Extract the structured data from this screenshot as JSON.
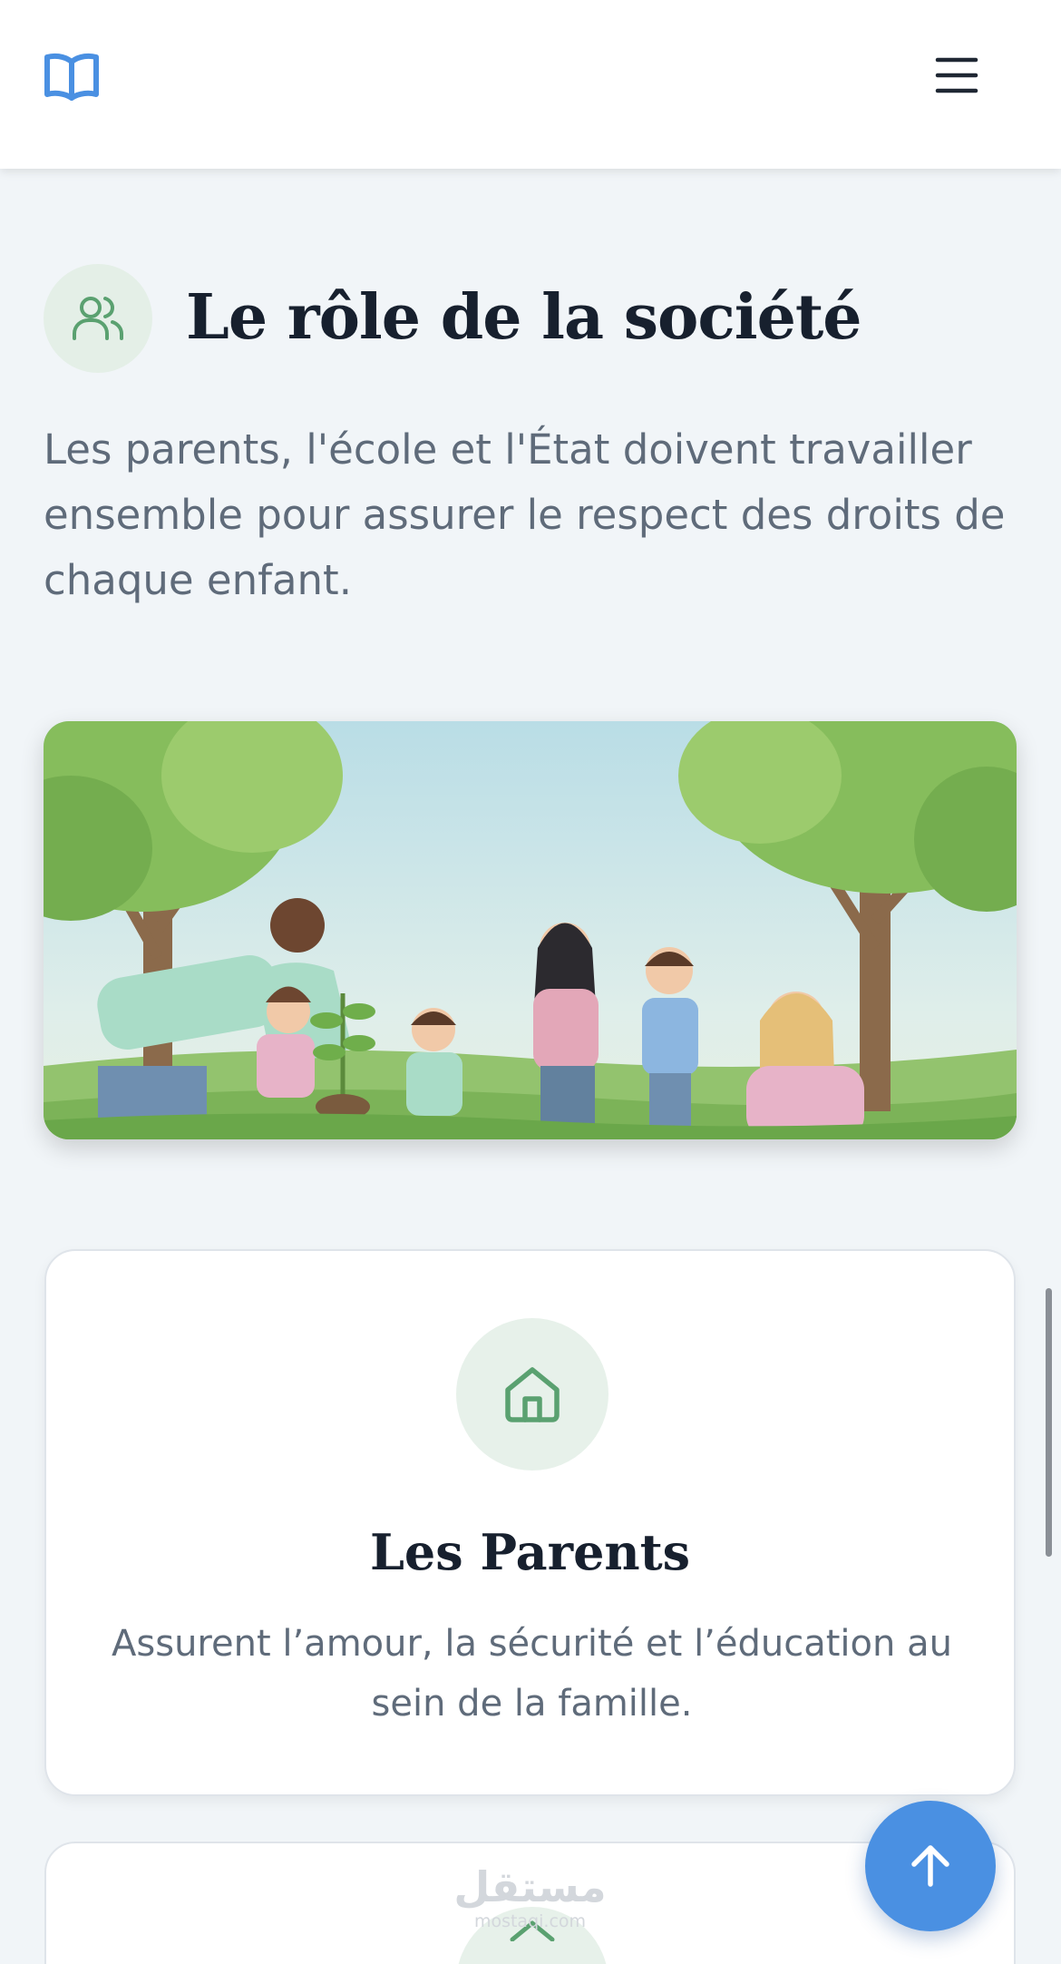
{
  "header": {
    "logo_icon": "open-book-icon",
    "menu_icon": "hamburger-menu-icon",
    "accent": "#4a90e2"
  },
  "section": {
    "icon": "users-icon",
    "title": "Le rôle de la société",
    "description": "Les parents, l'école et l'État doivent travailler ensemble pour assurer le respect des droits de chaque enfant."
  },
  "illustration": {
    "subject": "watercolor illustration of adults and children planting a tree in a park"
  },
  "cards": [
    {
      "icon": "home-icon",
      "title": "Les Parents",
      "description": "Assurent l’amour, la sécurité et l’éducation au sein de la famille."
    }
  ],
  "watermark": {
    "arabic": "مستقل",
    "latin": "mostaqi.com"
  },
  "scroll_top_icon": "arrow-up-icon",
  "colors": {
    "green_accent": "#5aa170",
    "green_bg": "#e7f1ea",
    "title": "#17202e",
    "text": "#5f6b7a",
    "page_bg": "#f1f5f8"
  }
}
